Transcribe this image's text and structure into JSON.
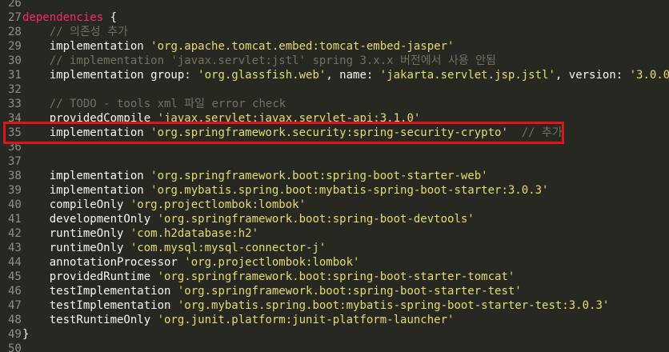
{
  "editor": {
    "lines": [
      {
        "n": "26",
        "parts": []
      },
      {
        "n": "27",
        "parts": [
          {
            "t": "dependencies",
            "c": "dep"
          },
          {
            "t": " {",
            "c": "brace"
          }
        ]
      },
      {
        "n": "28",
        "parts": [
          {
            "t": "    ",
            "c": "txt"
          },
          {
            "t": "// 의존성 추가",
            "c": "cm"
          }
        ]
      },
      {
        "n": "29",
        "parts": [
          {
            "t": "    implementation ",
            "c": "txt"
          },
          {
            "t": "'org.apache.tomcat.embed:tomcat-embed-jasper'",
            "c": "str"
          }
        ]
      },
      {
        "n": "30",
        "parts": [
          {
            "t": "    ",
            "c": "txt"
          },
          {
            "t": "// implementation 'javax.servlet:jstl' spring 3.x.x 버전에서 사용 안됨",
            "c": "cm"
          }
        ]
      },
      {
        "n": "31",
        "parts": [
          {
            "t": "    implementation group: ",
            "c": "txt"
          },
          {
            "t": "'org.glassfish.web'",
            "c": "str"
          },
          {
            "t": ", name: ",
            "c": "txt"
          },
          {
            "t": "'jakarta.servlet.jsp.jstl'",
            "c": "str"
          },
          {
            "t": ", version: ",
            "c": "txt"
          },
          {
            "t": "'3.0.0'",
            "c": "str"
          }
        ]
      },
      {
        "n": "32",
        "parts": []
      },
      {
        "n": "33",
        "parts": [
          {
            "t": "    ",
            "c": "txt"
          },
          {
            "t": "// TODO - tools xml 파일 error check",
            "c": "cm"
          }
        ]
      },
      {
        "n": "34",
        "parts": [
          {
            "t": "    providedCompile ",
            "c": "txt"
          },
          {
            "t": "'javax.servlet:javax.servlet-api:3.1.0'",
            "c": "str"
          }
        ]
      },
      {
        "n": "35",
        "parts": [
          {
            "t": "    implementation ",
            "c": "txt"
          },
          {
            "t": "'org.springframework.security:spring-security-crypto'",
            "c": "str"
          },
          {
            "t": "  ",
            "c": "txt"
          },
          {
            "t": "// 추가",
            "c": "cm"
          }
        ],
        "cursor": true
      },
      {
        "n": "36",
        "parts": []
      },
      {
        "n": "37",
        "parts": []
      },
      {
        "n": "38",
        "parts": [
          {
            "t": "    implementation ",
            "c": "txt"
          },
          {
            "t": "'org.springframework.boot:spring-boot-starter-web'",
            "c": "str"
          }
        ]
      },
      {
        "n": "39",
        "parts": [
          {
            "t": "    implementation ",
            "c": "txt"
          },
          {
            "t": "'org.mybatis.spring.boot:mybatis-spring-boot-starter:3.0.3'",
            "c": "str"
          }
        ]
      },
      {
        "n": "40",
        "parts": [
          {
            "t": "    compileOnly ",
            "c": "txt"
          },
          {
            "t": "'org.projectlombok:lombok'",
            "c": "str"
          }
        ]
      },
      {
        "n": "41",
        "parts": [
          {
            "t": "    developmentOnly ",
            "c": "txt"
          },
          {
            "t": "'org.springframework.boot:spring-boot-devtools'",
            "c": "str"
          }
        ]
      },
      {
        "n": "42",
        "parts": [
          {
            "t": "    runtimeOnly ",
            "c": "txt"
          },
          {
            "t": "'com.h2database:h2'",
            "c": "str"
          }
        ]
      },
      {
        "n": "43",
        "parts": [
          {
            "t": "    runtimeOnly ",
            "c": "txt"
          },
          {
            "t": "'com.mysql:mysql-connector-j'",
            "c": "str"
          }
        ]
      },
      {
        "n": "44",
        "parts": [
          {
            "t": "    annotationProcessor ",
            "c": "txt"
          },
          {
            "t": "'org.projectlombok:lombok'",
            "c": "str"
          }
        ]
      },
      {
        "n": "45",
        "parts": [
          {
            "t": "    providedRuntime ",
            "c": "txt"
          },
          {
            "t": "'org.springframework.boot:spring-boot-starter-tomcat'",
            "c": "str"
          }
        ]
      },
      {
        "n": "46",
        "parts": [
          {
            "t": "    testImplementation ",
            "c": "txt"
          },
          {
            "t": "'org.springframework.boot:spring-boot-starter-test'",
            "c": "str"
          }
        ]
      },
      {
        "n": "47",
        "parts": [
          {
            "t": "    testImplementation ",
            "c": "txt"
          },
          {
            "t": "'org.mybatis.spring.boot:mybatis-spring-boot-starter-test:3.0.3'",
            "c": "str"
          }
        ]
      },
      {
        "n": "48",
        "parts": [
          {
            "t": "    testRuntimeOnly ",
            "c": "txt"
          },
          {
            "t": "'org.junit.platform:junit-platform-launcher'",
            "c": "str"
          }
        ]
      },
      {
        "n": "49",
        "parts": [
          {
            "t": "}",
            "c": "brace"
          }
        ]
      },
      {
        "n": "50",
        "parts": []
      }
    ],
    "colors": {
      "background": "#272822",
      "string": "#e6db74",
      "comment": "#75715e",
      "keyword": "#f92672",
      "text": "#f8f8f2",
      "highlight_border": "#e0141e"
    }
  }
}
